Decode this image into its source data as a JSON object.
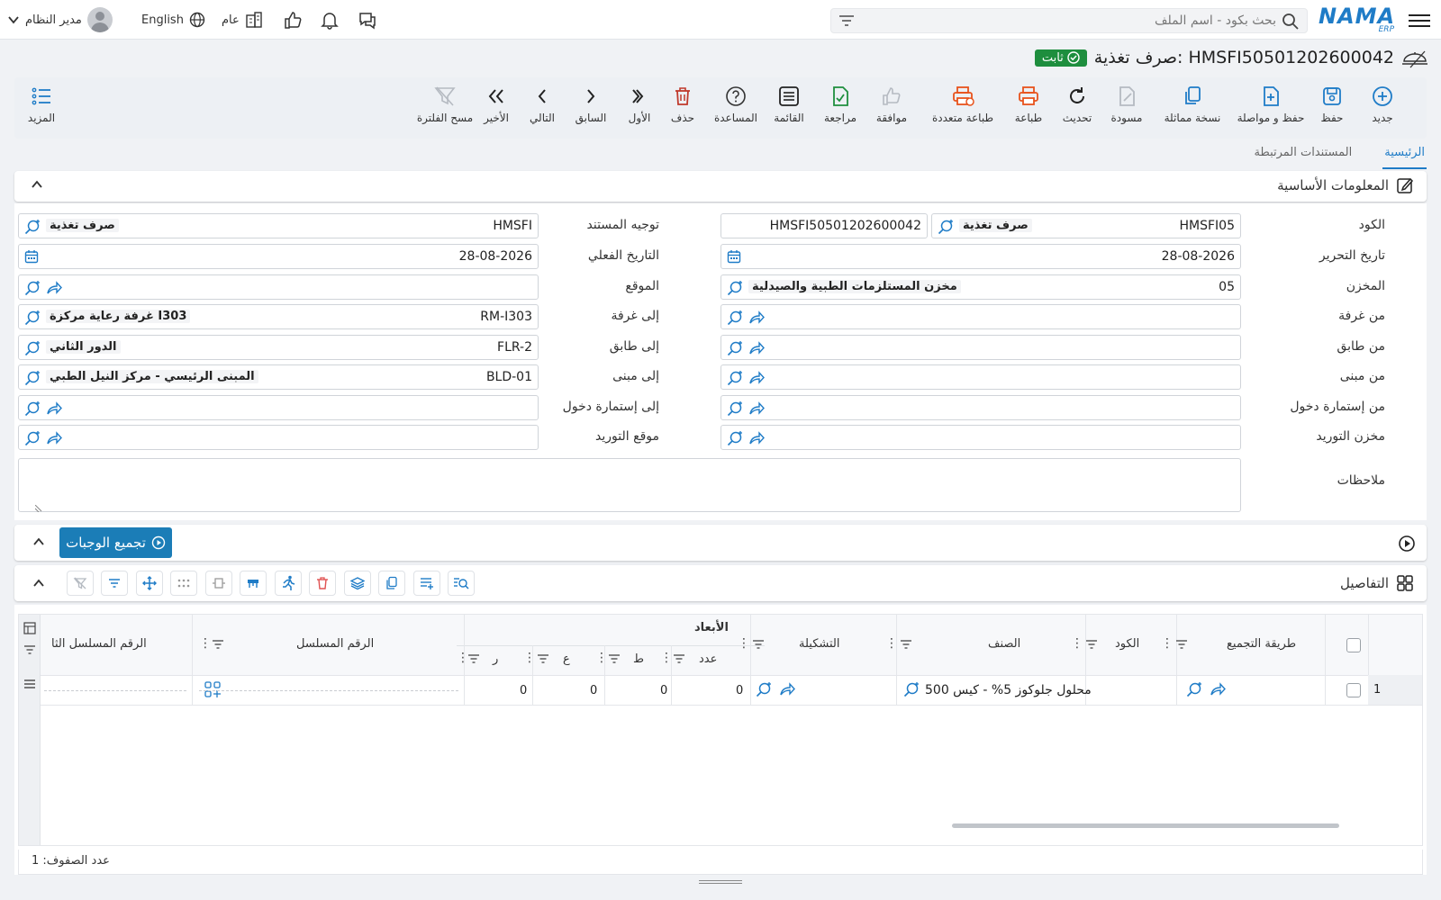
{
  "topbar": {
    "search_placeholder": "بحث بكود - اسم الملف",
    "user_name": "مدير النظام",
    "language": "English",
    "branch": "عام",
    "logo_text": "NAMA",
    "logo_sub": "ERP"
  },
  "title": {
    "text": "صرف تغذية: HMSFI50501202600042",
    "status": "ثابت"
  },
  "toolbar": {
    "new": "جديد",
    "save": "حفظ",
    "save_continue": "حفظ و مواصلة",
    "duplicate": "نسخة مماثلة",
    "draft": "مسودة",
    "refresh": "تحديث",
    "print": "طباعة",
    "multi_print": "طباعة متعددة",
    "approve": "موافقة",
    "review": "مراجعة",
    "list": "القائمة",
    "help": "المساعدة",
    "delete": "حذف",
    "first": "الأول",
    "previous": "السابق",
    "next": "التالي",
    "last": "الأخير",
    "clear_filter": "مسح الفلترة",
    "more": "المزيد"
  },
  "tabs": {
    "main": "الرئيسية",
    "related_docs": "المستندات المرتبطة"
  },
  "basic_info": {
    "section_title": "المعلومات الأساسية",
    "code_label": "الكود",
    "code_value": "HMSFI05",
    "code_ref": "صرف تغذية",
    "code_number": "HMSFI50501202600042",
    "doc_direction_label": "توجيه المستند",
    "doc_direction_value": "HMSFI",
    "doc_direction_ref": "صرف تغذية",
    "edit_date_label": "تاريخ التحرير",
    "edit_date_value": "28-08-2026",
    "actual_date_label": "التاريخ الفعلي",
    "actual_date_value": "28-08-2026",
    "warehouse_label": "المخزن",
    "warehouse_value": "05",
    "warehouse_ref": "مخزن المستلزمات الطبية والصيدلية",
    "location_label": "الموقع",
    "from_room_label": "من غرفة",
    "to_room_label": "إلى غرفة",
    "to_room_value": "RM-I303",
    "to_room_ref": "غرفة رعاية مركزة I303",
    "from_floor_label": "من طابق",
    "to_floor_label": "إلى طابق",
    "to_floor_value": "FLR-2",
    "to_floor_ref": "الدور الثاني",
    "from_building_label": "من مبنى",
    "to_building_label": "إلى مبنى",
    "to_building_value": "BLD-01",
    "to_building_ref": "المبنى الرئيسي - مركز النيل الطبي",
    "from_admission_label": "من إستمارة دخول",
    "to_admission_label": "إلى إستمارة دخول",
    "supply_warehouse_label": "مخزن التوريد",
    "supply_location_label": "موقع التوريد",
    "notes_label": "ملاحظات"
  },
  "meals": {
    "button": "تجميع الوجبات"
  },
  "details": {
    "title": "التفاصيل",
    "columns": {
      "collect_method": "طريقة التجميع",
      "code": "الكود",
      "item": "الصنف",
      "config": "التشكيلة",
      "dimensions": "الأبعاد",
      "count": "عدد",
      "t": "ط",
      "a": "ع",
      "r": "ر",
      "serial": "الرقم المسلسل",
      "serial2": "الرقم المسلسل الثا"
    },
    "rows": [
      {
        "index": "1",
        "item": "محلول جلوكوز 5% - كيس 500",
        "count": "0",
        "t": "0",
        "a": "0",
        "r": "0"
      }
    ],
    "row_count": "عدد الصفوف: 1"
  },
  "colors": {
    "accent": "#1f7cc7",
    "status_green": "#1e8e3e",
    "meals_button": "#1b7db7"
  }
}
